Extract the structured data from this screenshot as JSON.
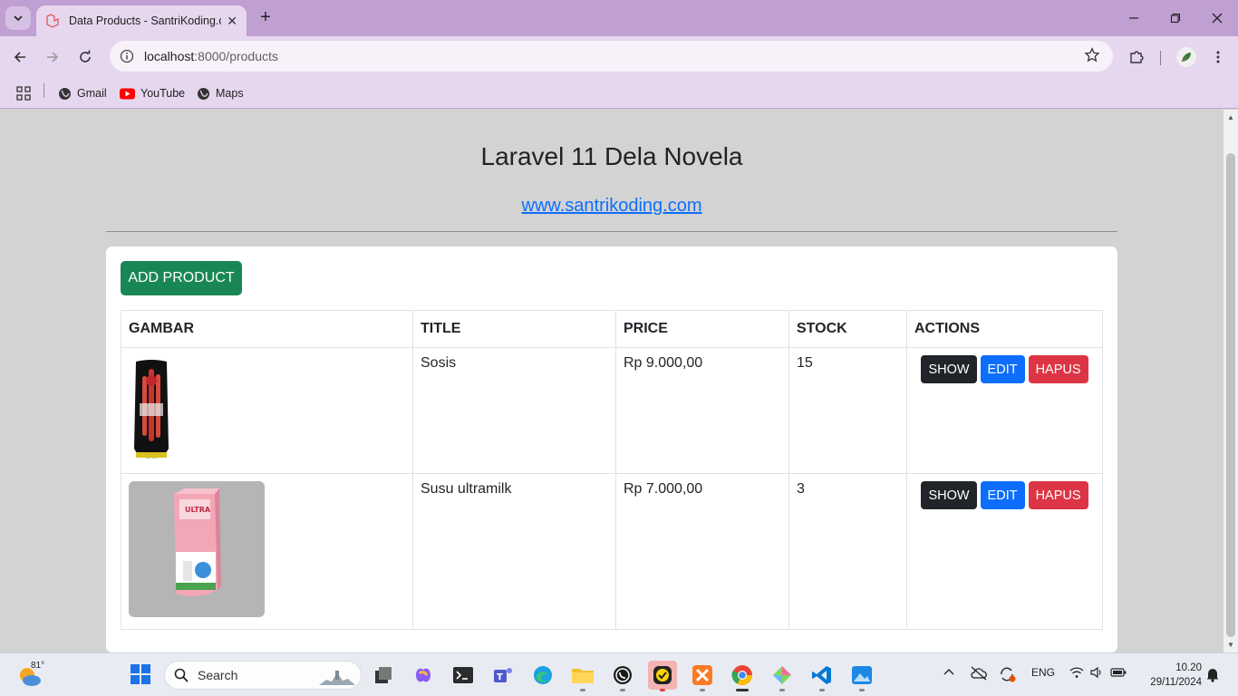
{
  "browser": {
    "tab_title": "Data Products - SantriKoding.com",
    "url_host": "localhost",
    "url_path": ":8000/products",
    "bookmarks": [
      {
        "label": "Gmail",
        "icon": "globe-icon"
      },
      {
        "label": "YouTube",
        "icon": "youtube-icon"
      },
      {
        "label": "Maps",
        "icon": "globe-icon"
      }
    ]
  },
  "page": {
    "title": "Laravel 11 Dela Novela",
    "link": "www.santrikoding.com",
    "add_button": "ADD PRODUCT",
    "table": {
      "headers": [
        "GAMBAR",
        "TITLE",
        "PRICE",
        "STOCK",
        "ACTIONS"
      ],
      "rows": [
        {
          "title": "Sosis",
          "price": "Rp 9.000,00",
          "stock": "15",
          "image": "sausage-product-image"
        },
        {
          "title": "Susu ultramilk",
          "price": "Rp 7.000,00",
          "stock": "3",
          "image": "ultramilk-product-image"
        }
      ],
      "actions": {
        "show": "SHOW",
        "edit": "EDIT",
        "delete": "HAPUS"
      }
    }
  },
  "taskbar": {
    "temperature": "81°",
    "search_placeholder": "Search",
    "language": "ENG",
    "time": "10.20",
    "date": "29/11/2024"
  },
  "colors": {
    "tab_bar": "#c09fd2",
    "toolbar": "#e6d7ef",
    "page_bg": "#d3d3d3",
    "success": "#198754",
    "primary": "#0d6efd",
    "danger": "#dc3545",
    "dark": "#212529"
  }
}
